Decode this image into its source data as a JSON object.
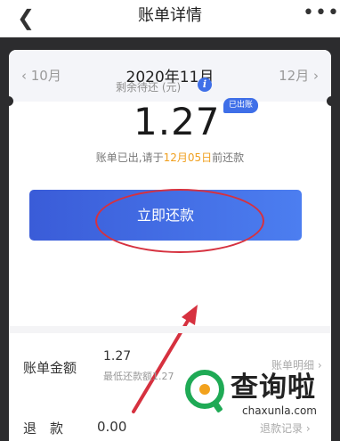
{
  "nav": {
    "back_icon": "chevron-left-icon",
    "title": "账单详情",
    "more_icon": "more-dots-icon"
  },
  "months": {
    "prev": "‹ 10月",
    "current": "2020年11月",
    "next": "12月 ›"
  },
  "summary": {
    "remain_label": "剩余待还 (元)",
    "amount": "1.27",
    "status_badge": "已出账",
    "due_prefix": "账单已出,请于",
    "due_date": "12月05日",
    "due_suffix": "前还款"
  },
  "actions": {
    "pay_label": "立即还款"
  },
  "bill": {
    "amount_label": "账单金额",
    "amount_value": "1.27",
    "min_payment": "最低还款额1.27",
    "detail_link": "账单明细 ›"
  },
  "refund": {
    "label": "退　款",
    "value": "0.00",
    "record_link": "退款记录 ›"
  },
  "watermark": {
    "name": "查询啦",
    "domain": "chaxunla.com"
  },
  "colors": {
    "accent": "#3f6fe8",
    "annotation": "#d6313f",
    "due_date": "#f0a020"
  }
}
